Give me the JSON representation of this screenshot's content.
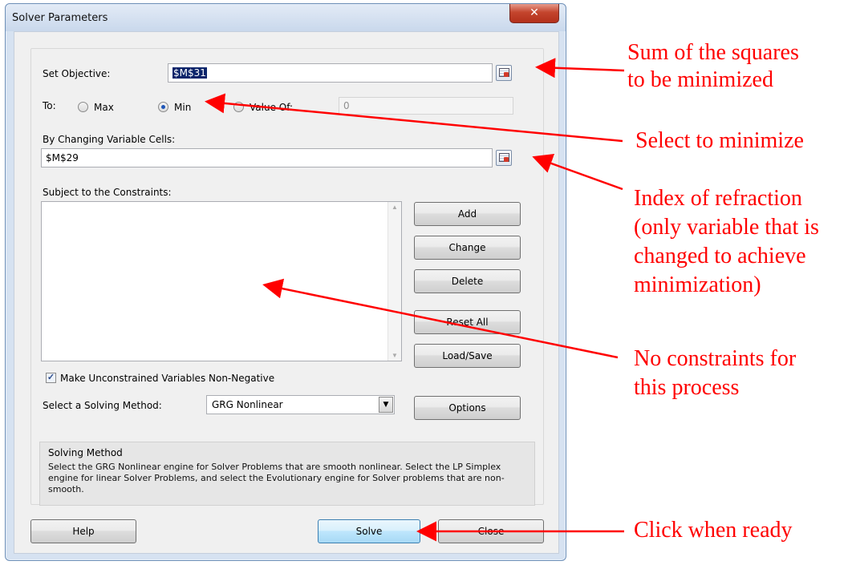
{
  "window": {
    "title": "Solver Parameters",
    "close_glyph": "✕"
  },
  "objective": {
    "label": "Set Objective:",
    "value": "$M$31"
  },
  "to": {
    "label": "To:",
    "max_label": "Max",
    "min_label": "Min",
    "valueof_label": "Value Of:",
    "value_of_value": "0",
    "selected": "Min"
  },
  "changing": {
    "label": "By Changing Variable Cells:",
    "value": "$M$29"
  },
  "constraints": {
    "label": "Subject to the Constraints:"
  },
  "buttons": {
    "add": "Add",
    "change": "Change",
    "delete": "Delete",
    "reset_all": "Reset All",
    "load_save": "Load/Save",
    "options": "Options",
    "help": "Help",
    "solve": "Solve",
    "close": "Close"
  },
  "nonneg": {
    "label": "Make Unconstrained Variables Non-Negative",
    "checked": true
  },
  "method": {
    "label": "Select a Solving Method:",
    "value": "GRG Nonlinear"
  },
  "method_box": {
    "title": "Solving Method",
    "description": "Select the GRG Nonlinear engine for Solver Problems that are smooth nonlinear. Select the LP Simplex engine for linear Solver Problems, and select the Evolutionary engine for Solver problems that are non-smooth."
  },
  "annotations": {
    "objective_note_1": "Sum of the squares",
    "objective_note_2": "to be minimized",
    "min_note": "Select to minimize",
    "index_note_1": "Index of refraction",
    "index_note_2": "(only variable that is",
    "index_note_3": "changed to achieve",
    "index_note_4": "minimization)",
    "constraints_note_1": "No constraints for",
    "constraints_note_2": "this process",
    "solve_note": "Click when ready"
  },
  "colors": {
    "annotation": "#ff0000",
    "titlebar": "#c9d8ec",
    "selection": "#0a246a"
  }
}
